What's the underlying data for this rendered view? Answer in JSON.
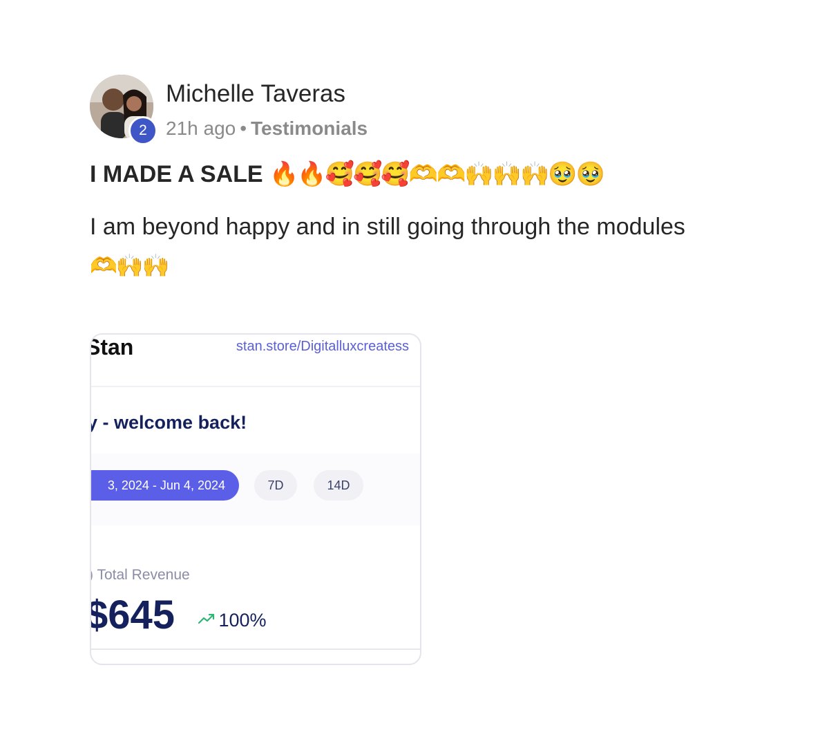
{
  "post": {
    "author": {
      "name": "Michelle Taveras",
      "level": "2"
    },
    "meta": {
      "time": "21h ago",
      "separator": "•",
      "category": "Testimonials"
    },
    "title": "I MADE A SALE",
    "title_emojis": "🔥🔥🥰🥰🥰🫶🫶🙌🙌🙌🥹🥹",
    "body": "I am beyond happy and in still going through the modules",
    "body_emojis": "🫶🙌🙌"
  },
  "attachment": {
    "logo": "Stan",
    "url": "stan.store/Digitalluxcreatess",
    "welcome": "y - welcome back!",
    "date_range": "3, 2024 - Jun 4, 2024",
    "filters": [
      "7D",
      "14D"
    ],
    "revenue_label": ") Total Revenue",
    "revenue_value": "$645",
    "trend_value": "100%",
    "colors": {
      "accent": "#5b5fe8",
      "navy": "#14215c",
      "trend_green": "#2bb673"
    }
  }
}
